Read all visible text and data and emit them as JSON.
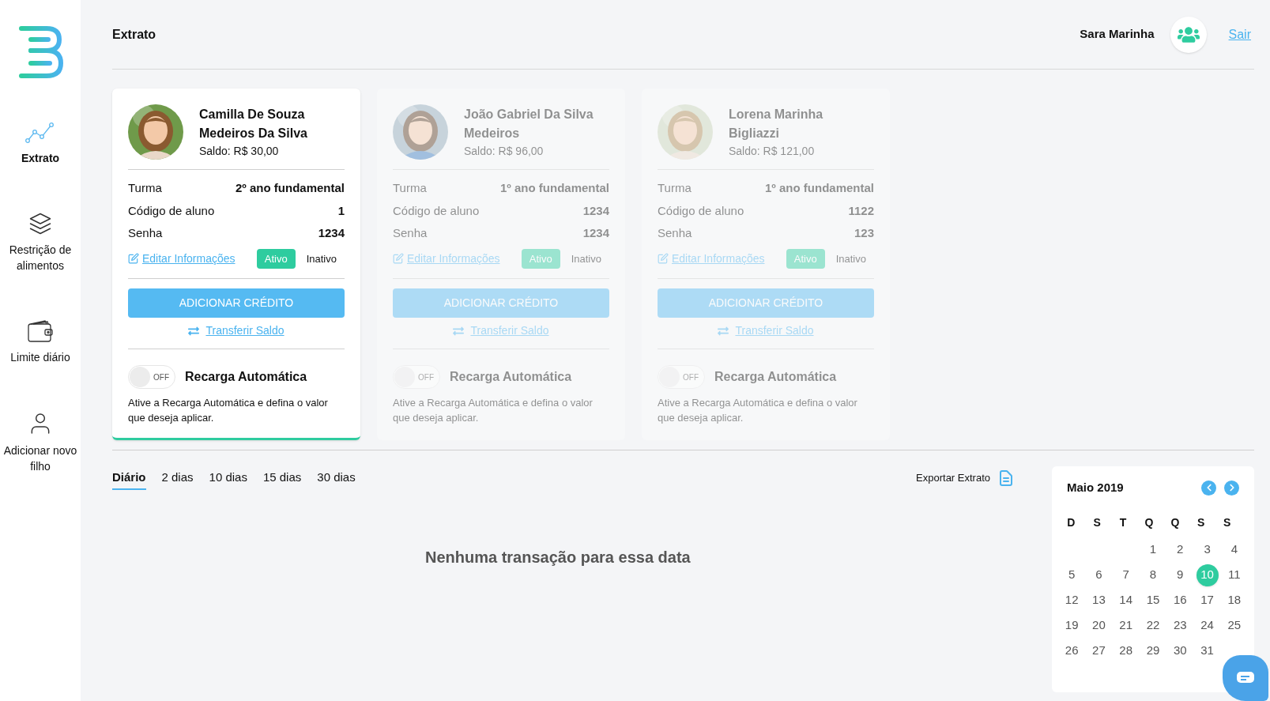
{
  "sidebar": {
    "items": [
      {
        "label": "Extrato",
        "selected": true
      },
      {
        "label": "Restrição de alimentos",
        "selected": false
      },
      {
        "label": "Limite diário",
        "selected": false
      },
      {
        "label": "Adicionar novo filho",
        "selected": false
      }
    ]
  },
  "header": {
    "title": "Extrato",
    "user": "Sara Marinha",
    "logout": "Sair"
  },
  "children": [
    {
      "name": "Camilla De Souza Medeiros Da Silva",
      "balance": "Saldo: R$ 30,00",
      "selected": true,
      "fields": [
        {
          "label": "Turma",
          "value": "2º ano fundamental"
        },
        {
          "label": "Código de aluno",
          "value": "1"
        },
        {
          "label": "Senha",
          "value": "1234"
        }
      ],
      "edit": "Editar Informações",
      "status": [
        {
          "label": "Ativo",
          "selected": true
        },
        {
          "label": "Inativo",
          "selected": false
        }
      ],
      "add_credit": "ADICIONAR CRÉDITO",
      "transfer": "Transferir Saldo",
      "auto_recharge": {
        "on": false,
        "switch_label": "OFF",
        "title": "Recarga Automática",
        "description": "Ative a Recarga Automática e defina o valor que deseja aplicar."
      }
    },
    {
      "name": "João Gabriel Da Silva Medeiros",
      "balance": "Saldo: R$ 96,00",
      "selected": false,
      "fields": [
        {
          "label": "Turma",
          "value": "1º ano fundamental"
        },
        {
          "label": "Código de aluno",
          "value": "1234"
        },
        {
          "label": "Senha",
          "value": "1234"
        }
      ],
      "edit": "Editar Informações",
      "status": [
        {
          "label": "Ativo",
          "selected": true
        },
        {
          "label": "Inativo",
          "selected": false
        }
      ],
      "add_credit": "ADICIONAR CRÉDITO",
      "transfer": "Transferir Saldo",
      "auto_recharge": {
        "on": false,
        "switch_label": "OFF",
        "title": "Recarga Automática",
        "description": "Ative a Recarga Automática e defina o valor que deseja aplicar."
      }
    },
    {
      "name": "Lorena Marinha Bigliazzi",
      "balance": "Saldo: R$ 121,00",
      "selected": false,
      "fields": [
        {
          "label": "Turma",
          "value": "1º ano fundamental"
        },
        {
          "label": "Código de aluno",
          "value": "1122"
        },
        {
          "label": "Senha",
          "value": "123"
        }
      ],
      "edit": "Editar Informações",
      "status": [
        {
          "label": "Ativo",
          "selected": true
        },
        {
          "label": "Inativo",
          "selected": false
        }
      ],
      "add_credit": "ADICIONAR CRÉDITO",
      "transfer": "Transferir Saldo",
      "auto_recharge": {
        "on": false,
        "switch_label": "OFF",
        "title": "Recarga Automática",
        "description": "Ative a Recarga Automática e defina o valor que deseja aplicar."
      }
    }
  ],
  "period_tabs": [
    {
      "label": "Diário",
      "selected": true
    },
    {
      "label": "2 dias",
      "selected": false
    },
    {
      "label": "10 dias",
      "selected": false
    },
    {
      "label": "15 dias",
      "selected": false
    },
    {
      "label": "30 dias",
      "selected": false
    }
  ],
  "export": "Exportar Extrato",
  "empty_message": "Nenhuma transação para essa data",
  "calendar": {
    "month": "Maio 2019",
    "weekdays": [
      "D",
      "S",
      "T",
      "Q",
      "Q",
      "S",
      "S"
    ],
    "weeks": [
      [
        {
          "day": "1",
          "selected": false
        },
        {
          "day": "2",
          "selected": false
        },
        {
          "day": "3",
          "selected": false
        },
        {
          "day": "4",
          "selected": false
        }
      ],
      [
        {
          "day": "5",
          "selected": false
        },
        {
          "day": "6",
          "selected": false
        },
        {
          "day": "7",
          "selected": false
        },
        {
          "day": "8",
          "selected": false
        },
        {
          "day": "9",
          "selected": false
        },
        {
          "day": "10",
          "selected": true
        },
        {
          "day": "11",
          "selected": false
        }
      ],
      [
        {
          "day": "12",
          "selected": false
        },
        {
          "day": "13",
          "selected": false
        },
        {
          "day": "14",
          "selected": false
        },
        {
          "day": "15",
          "selected": false
        },
        {
          "day": "16",
          "selected": false
        },
        {
          "day": "17",
          "selected": false
        },
        {
          "day": "18",
          "selected": false
        }
      ],
      [
        {
          "day": "19",
          "selected": false
        },
        {
          "day": "20",
          "selected": false
        },
        {
          "day": "21",
          "selected": false
        },
        {
          "day": "22",
          "selected": false
        },
        {
          "day": "23",
          "selected": false
        },
        {
          "day": "24",
          "selected": false
        },
        {
          "day": "25",
          "selected": false
        }
      ],
      [
        {
          "day": "26",
          "selected": false
        },
        {
          "day": "27",
          "selected": false
        },
        {
          "day": "28",
          "selected": false
        },
        {
          "day": "29",
          "selected": false
        },
        {
          "day": "30",
          "selected": false
        },
        {
          "day": "31",
          "selected": false
        }
      ]
    ]
  }
}
